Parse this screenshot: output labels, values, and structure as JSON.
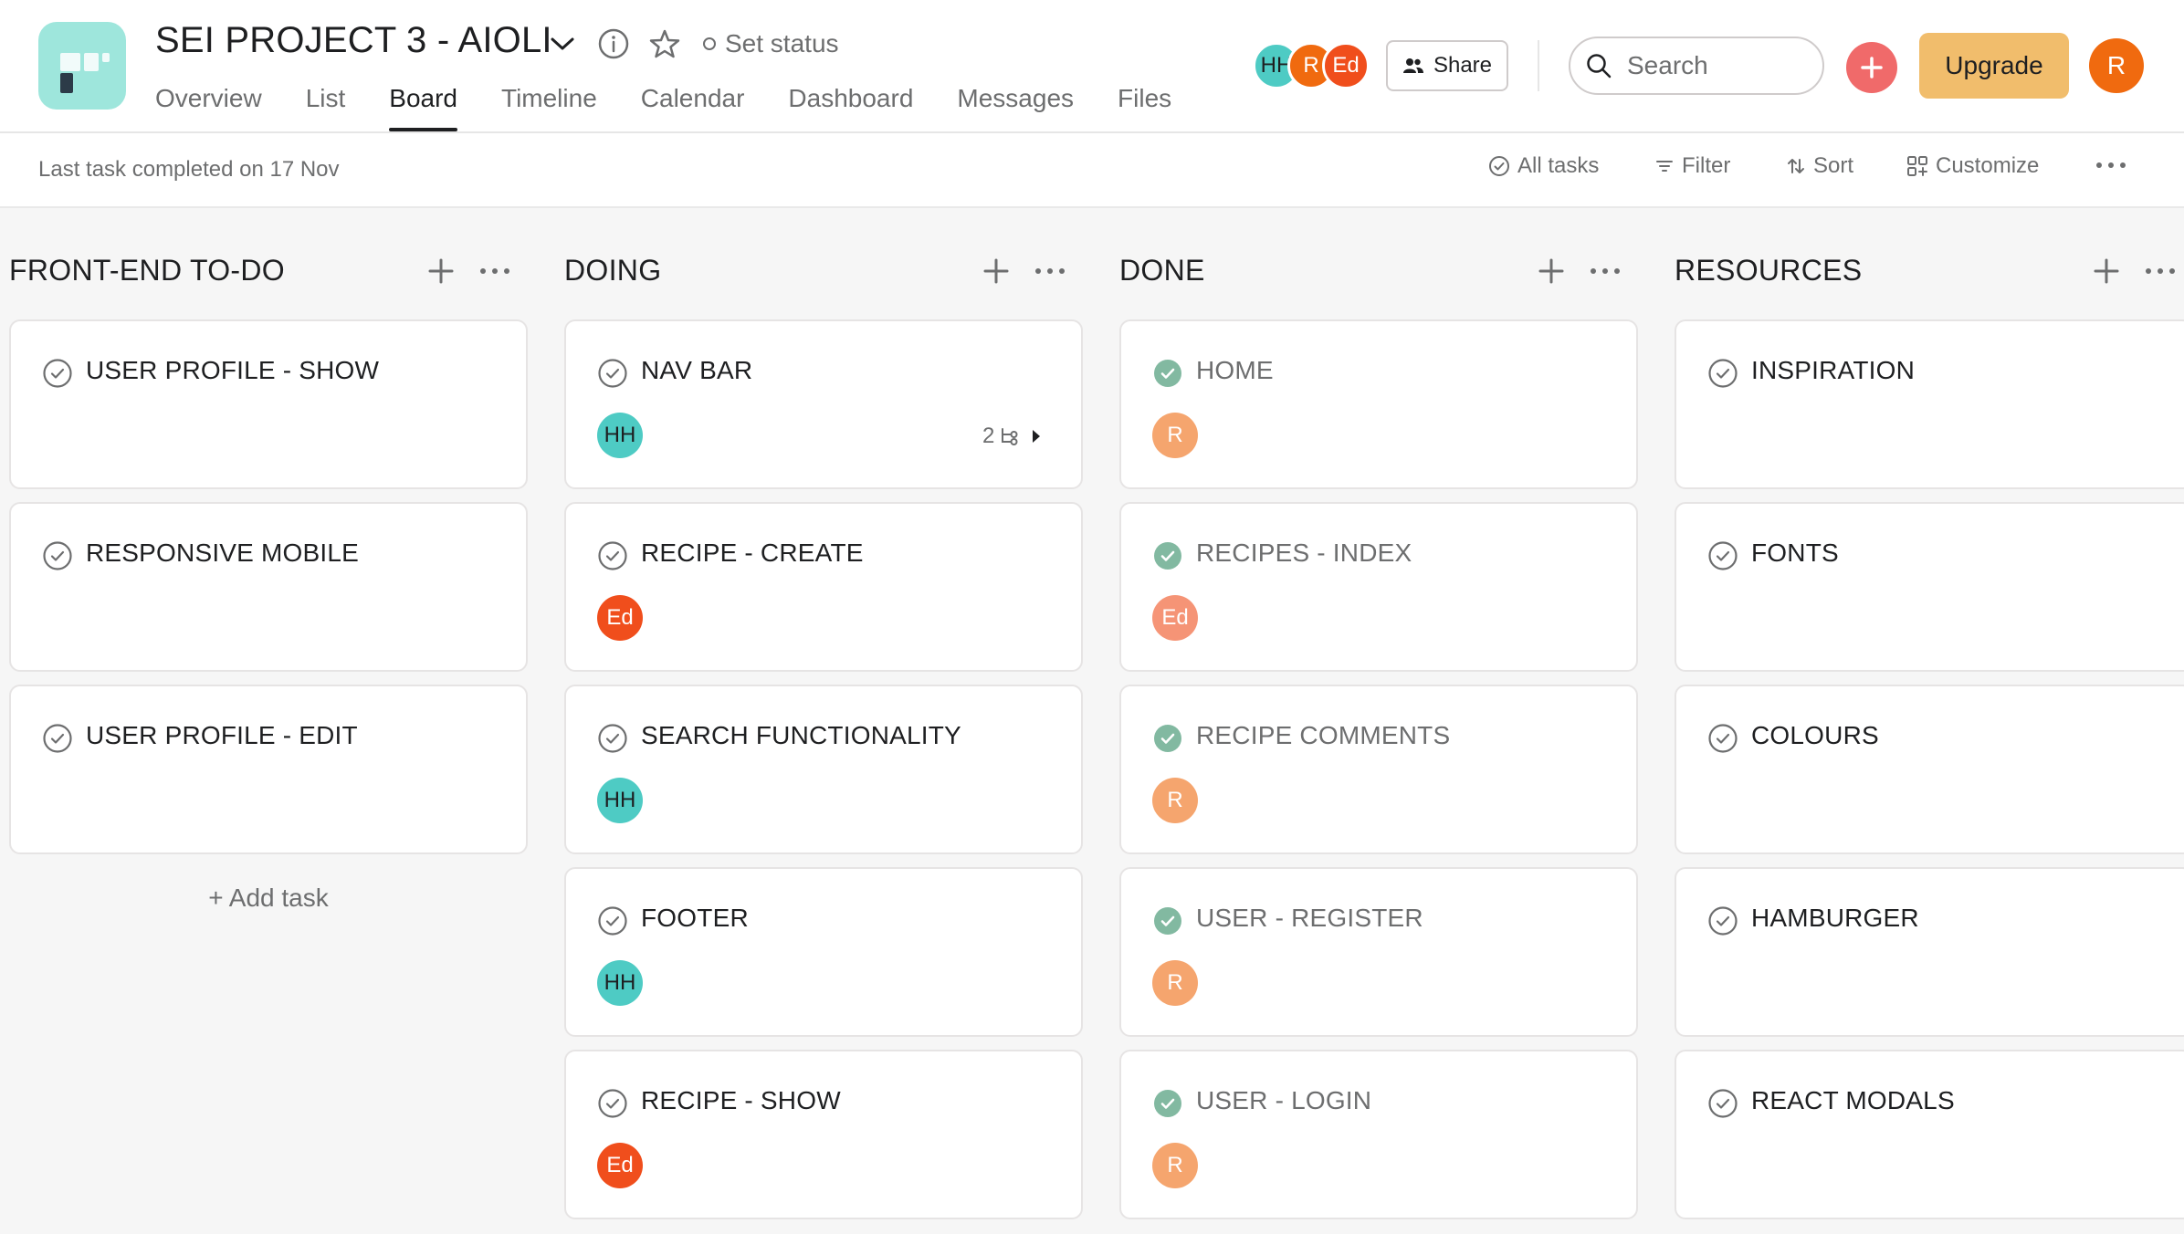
{
  "header": {
    "project_title": "SEI PROJECT 3 - AIOLI",
    "set_status": "Set status",
    "tabs": [
      {
        "label": "Overview",
        "active": false
      },
      {
        "label": "List",
        "active": false
      },
      {
        "label": "Board",
        "active": true
      },
      {
        "label": "Timeline",
        "active": false
      },
      {
        "label": "Calendar",
        "active": false
      },
      {
        "label": "Dashboard",
        "active": false
      },
      {
        "label": "Messages",
        "active": false
      },
      {
        "label": "Files",
        "active": false
      }
    ],
    "members": [
      "HH",
      "R",
      "Ed"
    ],
    "share_label": "Share",
    "search_placeholder": "Search",
    "upgrade_label": "Upgrade",
    "user_initial": "R"
  },
  "toolbar": {
    "last_task": "Last task completed on 17 Nov",
    "all_tasks": "All tasks",
    "filter": "Filter",
    "sort": "Sort",
    "customize": "Customize"
  },
  "board": {
    "columns": [
      {
        "title": "FRONT-END TO-DO",
        "add_task": "+ Add task",
        "cards": [
          {
            "name": "USER PROFILE - SHOW",
            "completed": false,
            "assignee": ""
          },
          {
            "name": "RESPONSIVE MOBILE",
            "completed": false,
            "assignee": ""
          },
          {
            "name": "USER PROFILE - EDIT",
            "completed": false,
            "assignee": ""
          }
        ]
      },
      {
        "title": "DOING",
        "cards": [
          {
            "name": "NAV BAR",
            "completed": false,
            "assignee": "HH",
            "subtasks": "2"
          },
          {
            "name": "RECIPE - CREATE",
            "completed": false,
            "assignee": "Ed"
          },
          {
            "name": "SEARCH FUNCTIONALITY",
            "completed": false,
            "assignee": "HH"
          },
          {
            "name": "FOOTER",
            "completed": false,
            "assignee": "HH"
          },
          {
            "name": "RECIPE - SHOW",
            "completed": false,
            "assignee": "Ed"
          }
        ]
      },
      {
        "title": "DONE",
        "cards": [
          {
            "name": "HOME",
            "completed": true,
            "assignee": "R"
          },
          {
            "name": "RECIPES - INDEX",
            "completed": true,
            "assignee": "Ed"
          },
          {
            "name": "RECIPE COMMENTS",
            "completed": true,
            "assignee": "R"
          },
          {
            "name": "USER - REGISTER",
            "completed": true,
            "assignee": "R"
          },
          {
            "name": "USER - LOGIN",
            "completed": true,
            "assignee": "R"
          }
        ]
      },
      {
        "title": "RESOURCES",
        "cards": [
          {
            "name": "INSPIRATION",
            "completed": false,
            "assignee": ""
          },
          {
            "name": "FONTS",
            "completed": false,
            "assignee": ""
          },
          {
            "name": "COLOURS",
            "completed": false,
            "assignee": ""
          },
          {
            "name": "HAMBURGER",
            "completed": false,
            "assignee": ""
          },
          {
            "name": "REACT MODALS",
            "completed": false,
            "assignee": ""
          }
        ]
      }
    ]
  },
  "colors": {
    "avatar_hh": "#4ecbc4",
    "avatar_r": "#f06a0f",
    "avatar_ed": "#f04e1c",
    "complete_check": "#58a182",
    "upgrade": "#f1bd6c",
    "add_button": "#f06a6a"
  }
}
